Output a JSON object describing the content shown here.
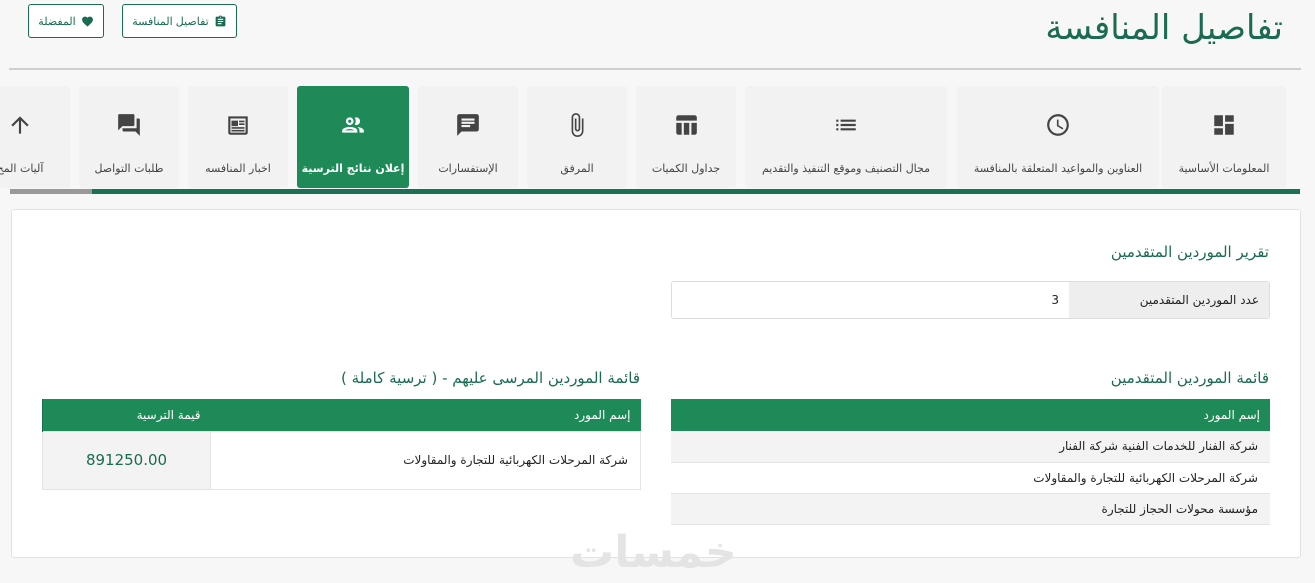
{
  "header": {
    "title": "تفاصيل المنافسة",
    "details_button": "تفاصيل المنافسة",
    "favorite_button": "المفضلة"
  },
  "tabs": [
    {
      "label": "المعلومات الأساسية",
      "icon": "dashboard-icon",
      "active": false
    },
    {
      "label": "العناوين والمواعيد المتعلقة بالمنافسة",
      "icon": "clock-icon",
      "active": false
    },
    {
      "label": "مجال التصنيف وموقع التنفيذ والتقديم",
      "icon": "list-icon",
      "active": false
    },
    {
      "label": "جداول الكميات",
      "icon": "table-icon",
      "active": false
    },
    {
      "label": "المرفق",
      "icon": "paperclip-icon",
      "active": false
    },
    {
      "label": "الإستفسارات",
      "icon": "message-icon",
      "active": false
    },
    {
      "label": "إعلان نتائج الترسية",
      "icon": "people-icon",
      "active": true
    },
    {
      "label": "اخبار المنافسه",
      "icon": "newspaper-icon",
      "active": false
    },
    {
      "label": "طلبات التواصل",
      "icon": "forum-icon",
      "active": false
    },
    {
      "label": "آليات المح",
      "icon": "arrow-up-icon",
      "active": false
    }
  ],
  "report": {
    "title": "تقرير الموردين المتقدمين",
    "count_label": "عدد الموردين المتقدمين",
    "count_value": "3"
  },
  "bidders": {
    "title": "قائمة الموردين المتقدمين",
    "column": "إسم المورد",
    "rows": [
      "شركة الفنار للخدمات الفنية شركة الفنار",
      "شركة المرحلات الكهربائية للتجارة والمقاولات",
      "مؤسسة محولات الحجاز للتجارة"
    ]
  },
  "winners": {
    "title": "قائمة الموردين المرسى عليهم - ( ترسية كاملة )",
    "col_supplier": "إسم المورد",
    "col_value": "قيمة الترسية",
    "rows": [
      {
        "supplier": "شركة المرحلات الكهربائية للتجارة والمقاولات",
        "value": "891250.00"
      }
    ]
  },
  "watermark": "خمسات",
  "colors": {
    "primary": "#1d8a58",
    "primary_dark": "#1a6b52",
    "tab_bg": "#f2f2f2"
  }
}
